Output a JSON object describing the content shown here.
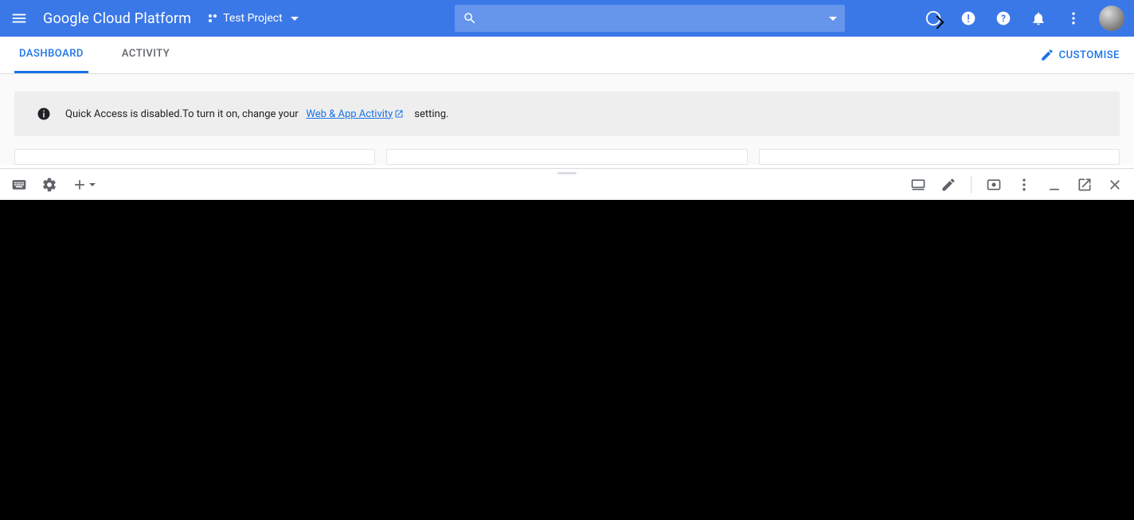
{
  "header": {
    "product_name": "Google Cloud Platform",
    "project_name": "Test Project",
    "search_placeholder": ""
  },
  "tabs": {
    "dashboard": "DASHBOARD",
    "activity": "ACTIVITY"
  },
  "customise_label": "CUSTOMISE",
  "banner": {
    "text_prefix": "Quick Access is disabled.To turn it on, change your",
    "link_label": "Web & App Activity",
    "text_suffix": "setting."
  }
}
